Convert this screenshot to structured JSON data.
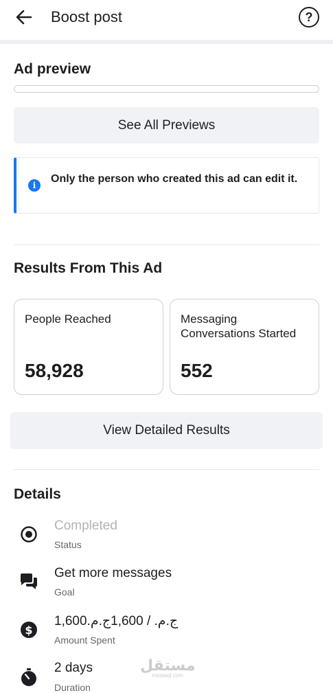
{
  "header": {
    "title": "Boost post",
    "help_symbol": "?"
  },
  "ad_preview": {
    "title": "Ad preview",
    "see_all_label": "See All Previews",
    "notice_text": "Only the person who created this ad can edit it.",
    "notice_icon": "i"
  },
  "results": {
    "title": "Results From This Ad",
    "stats": [
      {
        "label": "People Reached",
        "value": "58,928"
      },
      {
        "label": "Messaging Conversations Started",
        "value": "552"
      }
    ],
    "view_detailed_label": "View Detailed Results"
  },
  "details": {
    "title": "Details",
    "items": [
      {
        "icon": "status-radio-icon",
        "value": "Completed",
        "label": "Status"
      },
      {
        "icon": "chat-bubbles-icon",
        "value": "Get more messages",
        "label": "Goal"
      },
      {
        "icon": "dollar-coin-icon",
        "value": "1,600ج.م.‏ / 1,600ج.م.‏",
        "label": "Amount Spent"
      },
      {
        "icon": "stopwatch-icon",
        "value": "2 days",
        "label": "Duration"
      }
    ]
  },
  "watermark": {
    "main": "مستقل",
    "sub": "mostaql.com"
  },
  "colors": {
    "accent": "#1877f2",
    "button_bg": "#f0f2f5",
    "muted_text": "#b0b3b8",
    "secondary_text": "#65676b"
  }
}
